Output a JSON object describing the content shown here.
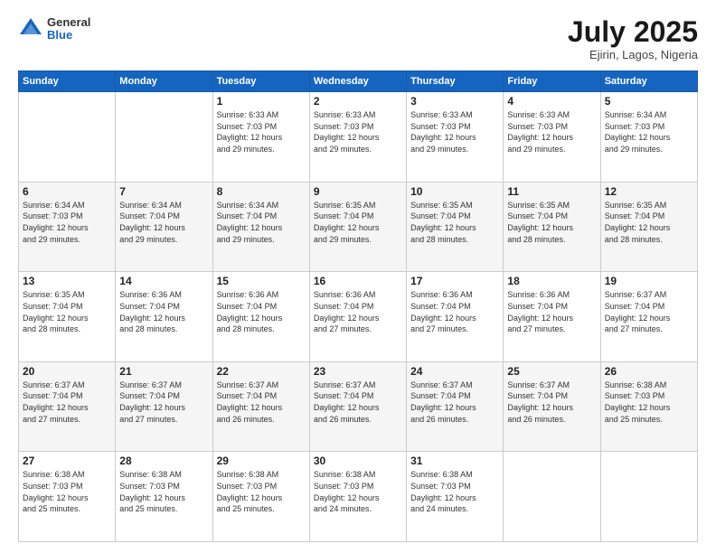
{
  "header": {
    "logo_line1": "General",
    "logo_line2": "Blue",
    "title": "July 2025",
    "subtitle": "Ejirin, Lagos, Nigeria"
  },
  "calendar": {
    "days_of_week": [
      "Sunday",
      "Monday",
      "Tuesday",
      "Wednesday",
      "Thursday",
      "Friday",
      "Saturday"
    ],
    "weeks": [
      [
        {
          "day": "",
          "info": ""
        },
        {
          "day": "",
          "info": ""
        },
        {
          "day": "1",
          "info": "Sunrise: 6:33 AM\nSunset: 7:03 PM\nDaylight: 12 hours\nand 29 minutes."
        },
        {
          "day": "2",
          "info": "Sunrise: 6:33 AM\nSunset: 7:03 PM\nDaylight: 12 hours\nand 29 minutes."
        },
        {
          "day": "3",
          "info": "Sunrise: 6:33 AM\nSunset: 7:03 PM\nDaylight: 12 hours\nand 29 minutes."
        },
        {
          "day": "4",
          "info": "Sunrise: 6:33 AM\nSunset: 7:03 PM\nDaylight: 12 hours\nand 29 minutes."
        },
        {
          "day": "5",
          "info": "Sunrise: 6:34 AM\nSunset: 7:03 PM\nDaylight: 12 hours\nand 29 minutes."
        }
      ],
      [
        {
          "day": "6",
          "info": "Sunrise: 6:34 AM\nSunset: 7:03 PM\nDaylight: 12 hours\nand 29 minutes."
        },
        {
          "day": "7",
          "info": "Sunrise: 6:34 AM\nSunset: 7:04 PM\nDaylight: 12 hours\nand 29 minutes."
        },
        {
          "day": "8",
          "info": "Sunrise: 6:34 AM\nSunset: 7:04 PM\nDaylight: 12 hours\nand 29 minutes."
        },
        {
          "day": "9",
          "info": "Sunrise: 6:35 AM\nSunset: 7:04 PM\nDaylight: 12 hours\nand 29 minutes."
        },
        {
          "day": "10",
          "info": "Sunrise: 6:35 AM\nSunset: 7:04 PM\nDaylight: 12 hours\nand 28 minutes."
        },
        {
          "day": "11",
          "info": "Sunrise: 6:35 AM\nSunset: 7:04 PM\nDaylight: 12 hours\nand 28 minutes."
        },
        {
          "day": "12",
          "info": "Sunrise: 6:35 AM\nSunset: 7:04 PM\nDaylight: 12 hours\nand 28 minutes."
        }
      ],
      [
        {
          "day": "13",
          "info": "Sunrise: 6:35 AM\nSunset: 7:04 PM\nDaylight: 12 hours\nand 28 minutes."
        },
        {
          "day": "14",
          "info": "Sunrise: 6:36 AM\nSunset: 7:04 PM\nDaylight: 12 hours\nand 28 minutes."
        },
        {
          "day": "15",
          "info": "Sunrise: 6:36 AM\nSunset: 7:04 PM\nDaylight: 12 hours\nand 28 minutes."
        },
        {
          "day": "16",
          "info": "Sunrise: 6:36 AM\nSunset: 7:04 PM\nDaylight: 12 hours\nand 27 minutes."
        },
        {
          "day": "17",
          "info": "Sunrise: 6:36 AM\nSunset: 7:04 PM\nDaylight: 12 hours\nand 27 minutes."
        },
        {
          "day": "18",
          "info": "Sunrise: 6:36 AM\nSunset: 7:04 PM\nDaylight: 12 hours\nand 27 minutes."
        },
        {
          "day": "19",
          "info": "Sunrise: 6:37 AM\nSunset: 7:04 PM\nDaylight: 12 hours\nand 27 minutes."
        }
      ],
      [
        {
          "day": "20",
          "info": "Sunrise: 6:37 AM\nSunset: 7:04 PM\nDaylight: 12 hours\nand 27 minutes."
        },
        {
          "day": "21",
          "info": "Sunrise: 6:37 AM\nSunset: 7:04 PM\nDaylight: 12 hours\nand 27 minutes."
        },
        {
          "day": "22",
          "info": "Sunrise: 6:37 AM\nSunset: 7:04 PM\nDaylight: 12 hours\nand 26 minutes."
        },
        {
          "day": "23",
          "info": "Sunrise: 6:37 AM\nSunset: 7:04 PM\nDaylight: 12 hours\nand 26 minutes."
        },
        {
          "day": "24",
          "info": "Sunrise: 6:37 AM\nSunset: 7:04 PM\nDaylight: 12 hours\nand 26 minutes."
        },
        {
          "day": "25",
          "info": "Sunrise: 6:37 AM\nSunset: 7:04 PM\nDaylight: 12 hours\nand 26 minutes."
        },
        {
          "day": "26",
          "info": "Sunrise: 6:38 AM\nSunset: 7:03 PM\nDaylight: 12 hours\nand 25 minutes."
        }
      ],
      [
        {
          "day": "27",
          "info": "Sunrise: 6:38 AM\nSunset: 7:03 PM\nDaylight: 12 hours\nand 25 minutes."
        },
        {
          "day": "28",
          "info": "Sunrise: 6:38 AM\nSunset: 7:03 PM\nDaylight: 12 hours\nand 25 minutes."
        },
        {
          "day": "29",
          "info": "Sunrise: 6:38 AM\nSunset: 7:03 PM\nDaylight: 12 hours\nand 25 minutes."
        },
        {
          "day": "30",
          "info": "Sunrise: 6:38 AM\nSunset: 7:03 PM\nDaylight: 12 hours\nand 24 minutes."
        },
        {
          "day": "31",
          "info": "Sunrise: 6:38 AM\nSunset: 7:03 PM\nDaylight: 12 hours\nand 24 minutes."
        },
        {
          "day": "",
          "info": ""
        },
        {
          "day": "",
          "info": ""
        }
      ]
    ]
  }
}
